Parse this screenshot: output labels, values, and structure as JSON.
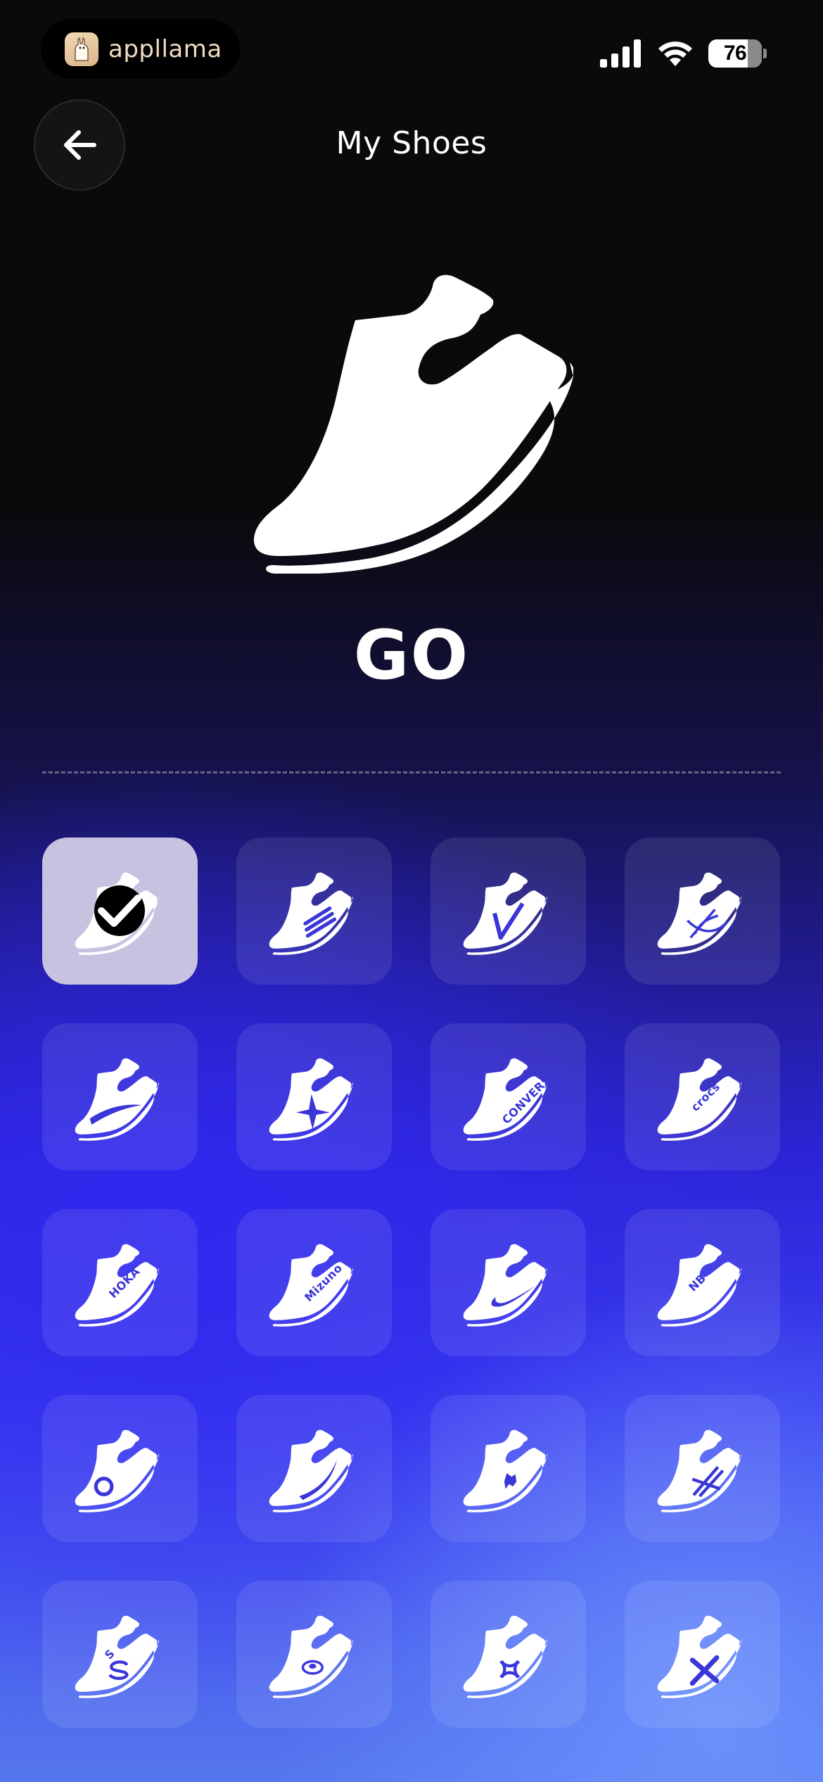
{
  "status_bar": {
    "app_name": "appllama",
    "battery": "76",
    "icons": [
      "cellular-signal-icon",
      "wifi-icon",
      "battery-icon"
    ]
  },
  "header": {
    "title": "My Shoes",
    "back_icon": "arrow-left-icon"
  },
  "selected_shoe": {
    "name": "GO",
    "icon": "running-shoe-icon"
  },
  "colors": {
    "background_top": "#0a0a0c",
    "gradient_blue": "#2c25d8",
    "gradient_light_blue": "#5577ee",
    "selected_tile": "#c7c2e0",
    "logo_accent": "#3a36d8"
  },
  "shoe_options": [
    {
      "id": "go",
      "icon": "plain-shoe-icon",
      "selected": true,
      "logo": ""
    },
    {
      "id": "adidas",
      "icon": "three-stripes-shoe-icon",
      "selected": false,
      "logo": ""
    },
    {
      "id": "v-stripe",
      "icon": "v-stripe-shoe-icon",
      "selected": false,
      "logo": ""
    },
    {
      "id": "asics",
      "icon": "asics-stripes-shoe-icon",
      "selected": false,
      "logo": ""
    },
    {
      "id": "brooks",
      "icon": "brooks-swoosh-shoe-icon",
      "selected": false,
      "logo": ""
    },
    {
      "id": "star",
      "icon": "star-shoe-icon",
      "selected": false,
      "logo": ""
    },
    {
      "id": "converse",
      "icon": "converse-star-shoe-icon",
      "selected": false,
      "logo": "CONVERSE"
    },
    {
      "id": "crocs",
      "icon": "crocs-shoe-icon",
      "selected": false,
      "logo": "crocs"
    },
    {
      "id": "hoka",
      "icon": "hoka-shoe-icon",
      "selected": false,
      "logo": "HOKA"
    },
    {
      "id": "mizuno",
      "icon": "mizuno-shoe-icon",
      "selected": false,
      "logo": "Mizuno"
    },
    {
      "id": "nike",
      "icon": "nike-swoosh-shoe-icon",
      "selected": false,
      "logo": ""
    },
    {
      "id": "new-balance",
      "icon": "new-balance-shoe-icon",
      "selected": false,
      "logo": "NB"
    },
    {
      "id": "on",
      "icon": "on-running-shoe-icon",
      "selected": false,
      "logo": ""
    },
    {
      "id": "puma",
      "icon": "puma-stripe-shoe-icon",
      "selected": false,
      "logo": ""
    },
    {
      "id": "polo",
      "icon": "polo-horse-shoe-icon",
      "selected": false,
      "logo": ""
    },
    {
      "id": "reebok",
      "icon": "reebok-vector-shoe-icon",
      "selected": false,
      "logo": ""
    },
    {
      "id": "skechers",
      "icon": "skechers-s-shoe-icon",
      "selected": false,
      "logo": "S"
    },
    {
      "id": "saucony",
      "icon": "saucony-shoe-icon",
      "selected": false,
      "logo": ""
    },
    {
      "id": "under-armour",
      "icon": "under-armour-shoe-icon",
      "selected": false,
      "logo": ""
    },
    {
      "id": "x-logo",
      "icon": "x-logo-shoe-icon",
      "selected": false,
      "logo": ""
    }
  ]
}
